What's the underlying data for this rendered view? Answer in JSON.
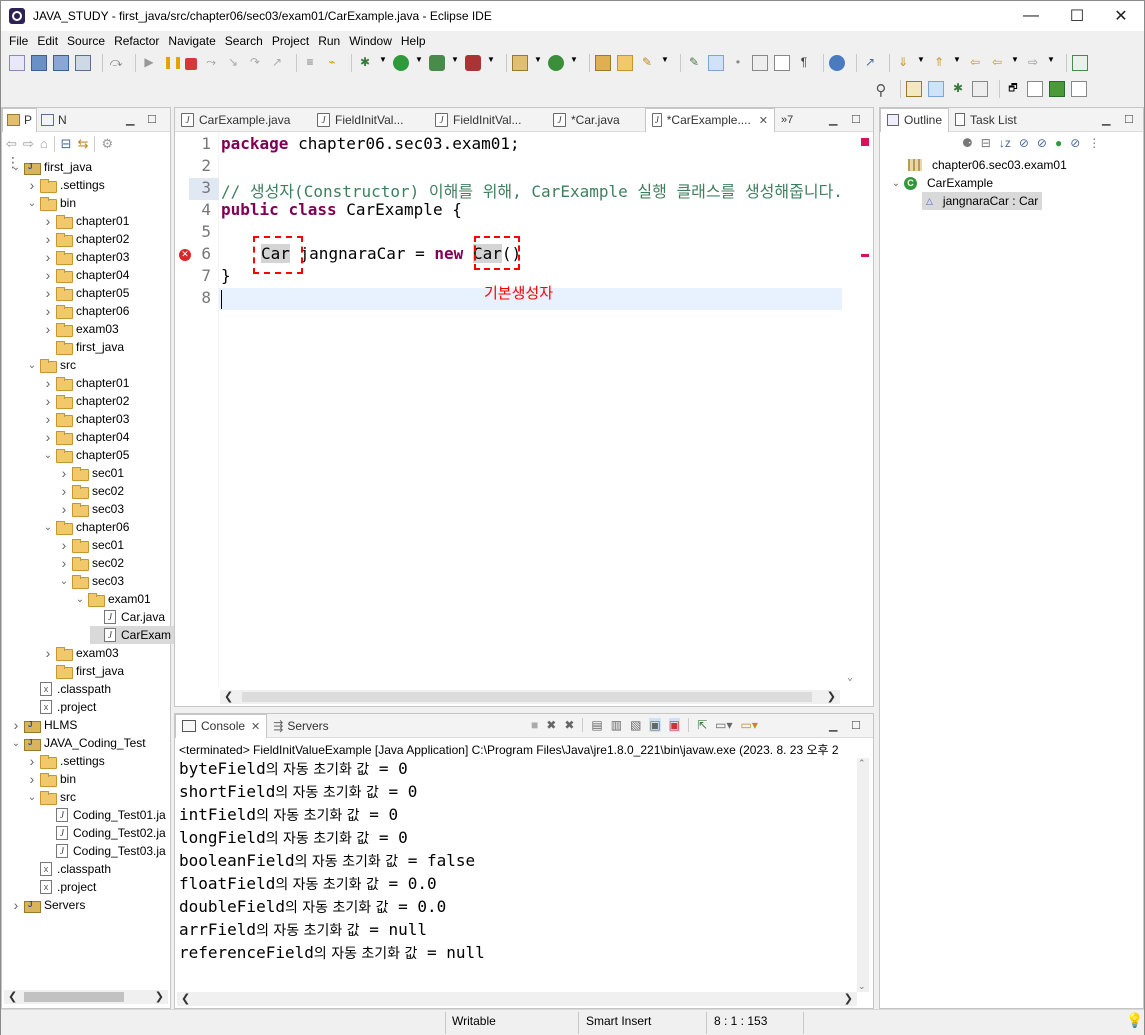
{
  "window": {
    "title": "JAVA_STUDY - first_java/src/chapter06/sec03/exam01/CarExample.java - Eclipse IDE",
    "minimize": "—",
    "maximize": "☐",
    "close": "✕"
  },
  "menu": [
    "File",
    "Edit",
    "Source",
    "Refactor",
    "Navigate",
    "Search",
    "Project",
    "Run",
    "Window",
    "Help"
  ],
  "explorer": {
    "tab1": "P",
    "tab2": "N",
    "rows": [
      {
        "label": "first_java",
        "depth": 0,
        "icon": "project",
        "twisty": "open"
      },
      {
        "label": ".settings",
        "depth": 1,
        "icon": "folder",
        "twisty": "closed"
      },
      {
        "label": "bin",
        "depth": 1,
        "icon": "folder",
        "twisty": "open"
      },
      {
        "label": "chapter01",
        "depth": 2,
        "icon": "folder",
        "twisty": "closed"
      },
      {
        "label": "chapter02",
        "depth": 2,
        "icon": "folder",
        "twisty": "closed"
      },
      {
        "label": "chapter03",
        "depth": 2,
        "icon": "folder",
        "twisty": "closed"
      },
      {
        "label": "chapter04",
        "depth": 2,
        "icon": "folder",
        "twisty": "closed"
      },
      {
        "label": "chapter05",
        "depth": 2,
        "icon": "folder",
        "twisty": "closed"
      },
      {
        "label": "chapter06",
        "depth": 2,
        "icon": "folder",
        "twisty": "closed"
      },
      {
        "label": "exam03",
        "depth": 2,
        "icon": "folder",
        "twisty": "closed"
      },
      {
        "label": "first_java",
        "depth": 2,
        "icon": "folder",
        "twisty": "none"
      },
      {
        "label": "src",
        "depth": 1,
        "icon": "folder",
        "twisty": "open"
      },
      {
        "label": "chapter01",
        "depth": 2,
        "icon": "folder",
        "twisty": "closed"
      },
      {
        "label": "chapter02",
        "depth": 2,
        "icon": "folder",
        "twisty": "closed"
      },
      {
        "label": "chapter03",
        "depth": 2,
        "icon": "folder",
        "twisty": "closed"
      },
      {
        "label": "chapter04",
        "depth": 2,
        "icon": "folder",
        "twisty": "closed"
      },
      {
        "label": "chapter05",
        "depth": 2,
        "icon": "folder",
        "twisty": "open"
      },
      {
        "label": "sec01",
        "depth": 3,
        "icon": "folder",
        "twisty": "closed"
      },
      {
        "label": "sec02",
        "depth": 3,
        "icon": "folder",
        "twisty": "closed"
      },
      {
        "label": "sec03",
        "depth": 3,
        "icon": "folder",
        "twisty": "closed"
      },
      {
        "label": "chapter06",
        "depth": 2,
        "icon": "folder",
        "twisty": "open"
      },
      {
        "label": "sec01",
        "depth": 3,
        "icon": "folder",
        "twisty": "closed"
      },
      {
        "label": "sec02",
        "depth": 3,
        "icon": "folder",
        "twisty": "closed"
      },
      {
        "label": "sec03",
        "depth": 3,
        "icon": "folder",
        "twisty": "open"
      },
      {
        "label": "exam01",
        "depth": 4,
        "icon": "folder",
        "twisty": "open"
      },
      {
        "label": "Car.java",
        "depth": 5,
        "icon": "java",
        "twisty": "none"
      },
      {
        "label": "CarExam",
        "depth": 5,
        "icon": "java",
        "twisty": "none",
        "selected": true
      },
      {
        "label": "exam03",
        "depth": 2,
        "icon": "folder",
        "twisty": "closed"
      },
      {
        "label": "first_java",
        "depth": 2,
        "icon": "folder",
        "twisty": "none"
      },
      {
        "label": ".classpath",
        "depth": 1,
        "icon": "xml",
        "twisty": "none"
      },
      {
        "label": ".project",
        "depth": 1,
        "icon": "xml",
        "twisty": "none"
      },
      {
        "label": "HLMS",
        "depth": 0,
        "icon": "project",
        "twisty": "closed"
      },
      {
        "label": "JAVA_Coding_Test",
        "depth": 0,
        "icon": "project",
        "twisty": "open"
      },
      {
        "label": ".settings",
        "depth": 1,
        "icon": "folder",
        "twisty": "closed"
      },
      {
        "label": "bin",
        "depth": 1,
        "icon": "folder",
        "twisty": "closed"
      },
      {
        "label": "src",
        "depth": 1,
        "icon": "folder",
        "twisty": "open"
      },
      {
        "label": "Coding_Test01.ja",
        "depth": 2,
        "icon": "java",
        "twisty": "none"
      },
      {
        "label": "Coding_Test02.ja",
        "depth": 2,
        "icon": "java",
        "twisty": "none"
      },
      {
        "label": "Coding_Test03.ja",
        "depth": 2,
        "icon": "java",
        "twisty": "none"
      },
      {
        "label": ".classpath",
        "depth": 1,
        "icon": "xml",
        "twisty": "none"
      },
      {
        "label": ".project",
        "depth": 1,
        "icon": "xml",
        "twisty": "none"
      },
      {
        "label": "Servers",
        "depth": 0,
        "icon": "project",
        "twisty": "closed"
      }
    ]
  },
  "editor": {
    "tabs": [
      "CarExample.java",
      "FieldInitVal...",
      "FieldInitVal...",
      "*Car.java",
      "*CarExample...."
    ],
    "active_tab": 4,
    "overflow": "»7",
    "lines": {
      "n1": "1",
      "n2": "2",
      "n3": "3",
      "n4": "4",
      "n5": "5",
      "n6": "6",
      "n7": "7",
      "n8": "8",
      "l1_kw": "package",
      "l1_rest": " chapter06.sec03.exam01;",
      "l3": "// 생성자(Constructor) 이해를 위해, CarExample 실행 클래스를 생성해줍니다.",
      "l4_kw1": "public",
      "l4_kw2": "class",
      "l4_rest": " CarExample {",
      "l6_type": "Car",
      "l6_mid": " jangnaraCar = ",
      "l6_kw": "new",
      "l6_ctor": "Car",
      "l6_end": "()",
      "l7": "}"
    },
    "annotation": "기본생성자",
    "annotation_color": "#ff0000"
  },
  "console": {
    "tab": "Console",
    "tab2": "Servers",
    "header": "<terminated> FieldInitValueExample [Java Application] C:\\Program Files\\Java\\jre1.8.0_221\\bin\\javaw.exe  (2023. 8. 23 오후 2",
    "lines": [
      {
        "field": "byteField",
        "ko": "의 자동 초기화 값",
        "val": " = 0"
      },
      {
        "field": "shortField",
        "ko": "의 자동 초기화 값",
        "val": " = 0"
      },
      {
        "field": "intField",
        "ko": "의 자동 초기화 값",
        "val": " = 0"
      },
      {
        "field": "longField",
        "ko": "의 자동 초기화 값",
        "val": " = 0"
      },
      {
        "field": "booleanField",
        "ko": "의 자동 초기화 값",
        "val": " = false"
      },
      {
        "field": "floatField",
        "ko": "의 자동 초기화 값",
        "val": " = 0.0"
      },
      {
        "field": "doubleField",
        "ko": "의 자동 초기화 값",
        "val": " = 0.0"
      },
      {
        "field": "arrField",
        "ko": "의 자동 초기화 값",
        "val": " = null"
      },
      {
        "field": "referenceField",
        "ko": "의 자동 초기화 값",
        "val": " = null"
      }
    ]
  },
  "outline": {
    "tab": "Outline",
    "tab2": "Task List",
    "package": "chapter06.sec03.exam01",
    "class": "CarExample",
    "field": "jangnaraCar : Car"
  },
  "status": {
    "writable": "Writable",
    "insert": "Smart Insert",
    "position": "8 : 1 : 153"
  }
}
